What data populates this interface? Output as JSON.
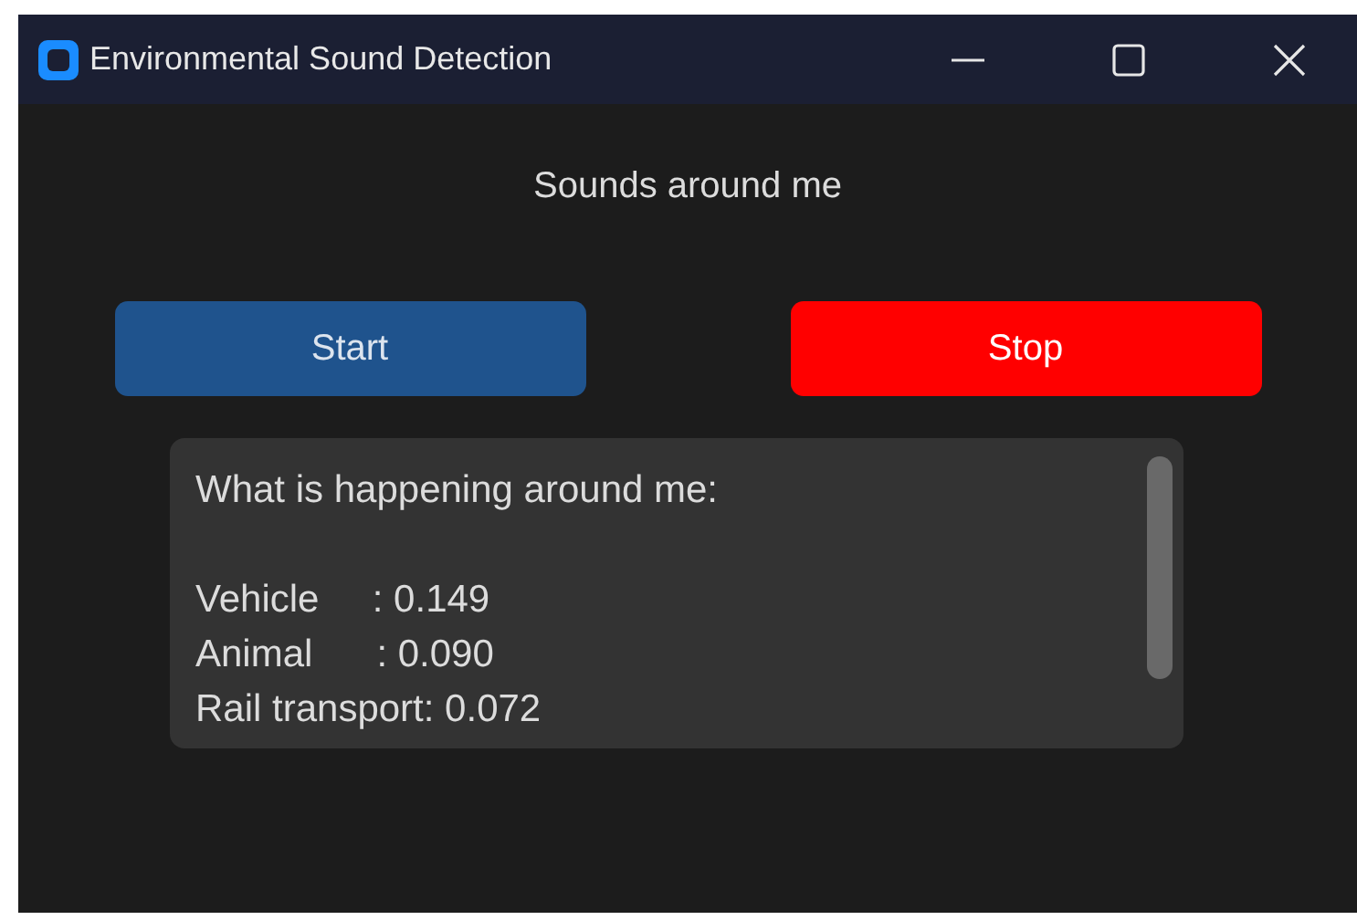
{
  "window": {
    "title": "Environmental Sound Detection"
  },
  "heading": "Sounds around me",
  "buttons": [
    {
      "label": "Start",
      "kind": "start"
    },
    {
      "label": "Stop",
      "kind": "stop"
    }
  ],
  "output": {
    "header": "What is happening around me:",
    "lines": [
      "Vehicle     : 0.149",
      "Animal      : 0.090",
      "Rail transport: 0.072"
    ]
  }
}
